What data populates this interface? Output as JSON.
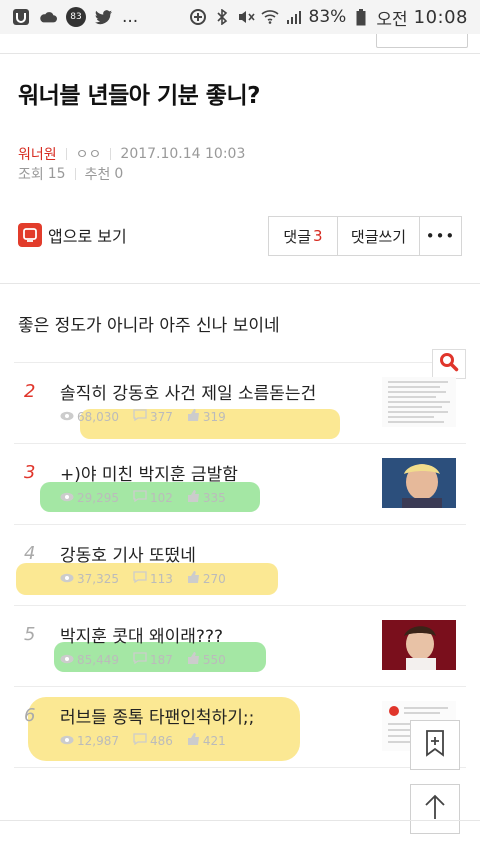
{
  "status_bar": {
    "notif_badge": "83",
    "battery": "83%",
    "ampm": "오전",
    "time": "10:08",
    "dots": "..."
  },
  "article": {
    "title": "워너블 년들아 기분 좋니?",
    "author": "워너원",
    "author_sub": "ㅇㅇ",
    "datetime": "2017.10.14 10:03",
    "views_label": "조회",
    "views": "15",
    "likes_label": "추천",
    "likes": "0",
    "body": "좋은 정도가 아니라 아주 신나 보이네"
  },
  "actions": {
    "app_icon_text": "app",
    "app_label": "앱으로 보기",
    "comments_label": "댓글",
    "comments_count": "3",
    "write_comment": "댓글쓰기",
    "more": "•••"
  },
  "list": [
    {
      "rank": "2",
      "title": "솔직히 강동호 사건 제일 소름돋는건",
      "views": "68,030",
      "comments": "377",
      "likes": "319",
      "rank_color": "red"
    },
    {
      "rank": "3",
      "title": "+)야 미친 박지훈 금발함",
      "views": "29,295",
      "comments": "102",
      "likes": "335",
      "rank_color": "red"
    },
    {
      "rank": "4",
      "title": "강동호 기사 또떴네",
      "views": "37,325",
      "comments": "113",
      "likes": "270",
      "rank_color": "gray"
    },
    {
      "rank": "5",
      "title": "박지훈 콧대 왜이래???",
      "views": "85,449",
      "comments": "187",
      "likes": "550",
      "rank_color": "gray"
    },
    {
      "rank": "6",
      "title": "러브들 종톡 타팬인척하기;;",
      "views": "12,987",
      "comments": "486",
      "likes": "421",
      "rank_color": "gray"
    }
  ],
  "colors": {
    "accent_red": "#e0352b",
    "highlight_yellow": "#f7d53a",
    "highlight_green": "#59d35a"
  }
}
